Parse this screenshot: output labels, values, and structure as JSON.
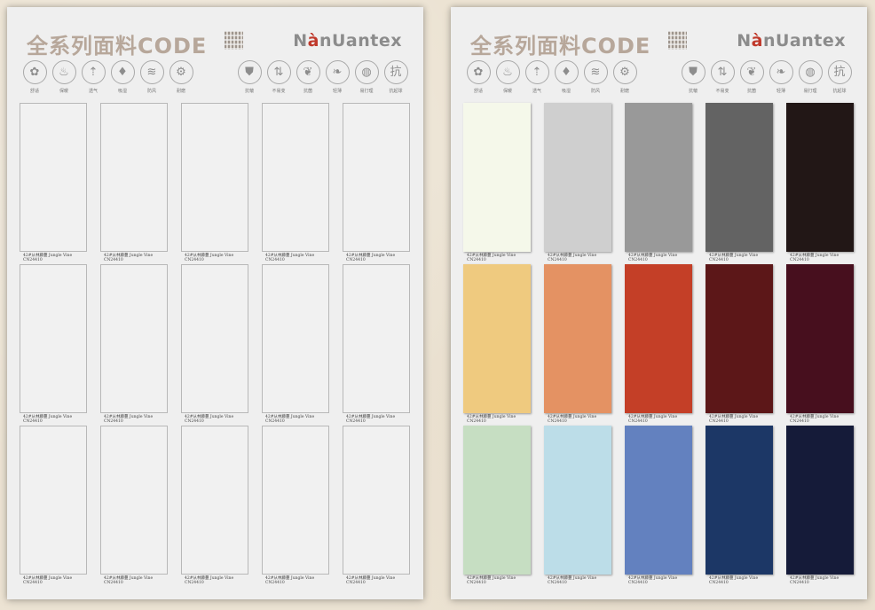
{
  "header": {
    "title": "全系列面料CODE",
    "brand_prefix": "N",
    "brand_accent": "à",
    "brand_suffix": "nUantex"
  },
  "features_left": [
    {
      "label": "舒适",
      "icon": "flower-icon",
      "glyph": "✿"
    },
    {
      "label": "保暖",
      "icon": "flame-icon",
      "glyph": "♨"
    },
    {
      "label": "透气",
      "icon": "vent-icon",
      "glyph": "⇡"
    },
    {
      "label": "吸湿",
      "icon": "droplet-icon",
      "glyph": "♦"
    },
    {
      "label": "防风",
      "icon": "wind-icon",
      "glyph": "≋"
    },
    {
      "label": "耐磨",
      "icon": "gear-icon",
      "glyph": "⚙"
    }
  ],
  "features_right": [
    {
      "label": "抗皱",
      "icon": "shirt-icon",
      "glyph": "⛊"
    },
    {
      "label": "不易变",
      "icon": "stretch-icon",
      "glyph": "⇅"
    },
    {
      "label": "抗菌",
      "icon": "leaf-icon",
      "glyph": "❦"
    },
    {
      "label": "轻薄",
      "icon": "feather-icon",
      "glyph": "❧"
    },
    {
      "label": "易打理",
      "icon": "water-icon",
      "glyph": "◍"
    },
    {
      "label": "抗起球",
      "icon": "anti-pill-icon",
      "glyph": "抗"
    }
  ],
  "swatch_caption": {
    "line1": "42#从林藤蔓 Jungle Vine",
    "line2": "CN24410"
  },
  "swatch_colors": [
    "#f5f8ea",
    "#cfcfcf",
    "#999999",
    "#636363",
    "#221716",
    "#efca7f",
    "#e49263",
    "#c43f27",
    "#5c1718",
    "#470f1e",
    "#c6dec2",
    "#bcdde8",
    "#6381bf",
    "#1c3766",
    "#151b39"
  ],
  "colors": {
    "title": "#b7a79a",
    "brand_accent": "#c0392b"
  }
}
